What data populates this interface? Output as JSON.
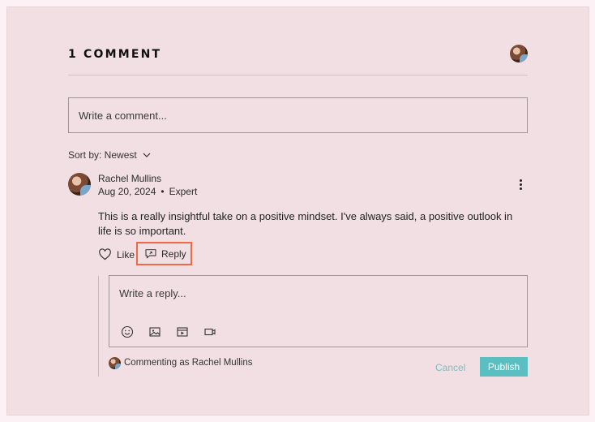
{
  "header": {
    "title": "1 COMMENT"
  },
  "composer": {
    "placeholder": "Write a comment..."
  },
  "sort": {
    "label": "Sort by: Newest"
  },
  "comment": {
    "author": "Rachel Mullins",
    "date": "Aug 20, 2024",
    "separator": "•",
    "role": "Expert",
    "text": "This is a really insightful take on a positive mindset. I've always said, a positive outlook in life is so important.",
    "like_label": "Like",
    "reply_label": "Reply"
  },
  "reply": {
    "placeholder": "Write a reply...",
    "tools": [
      "emoji-icon",
      "image-icon",
      "gif-icon",
      "video-icon"
    ],
    "commenting_as": "Commenting as Rachel Mullins",
    "cancel_label": "Cancel",
    "publish_label": "Publish"
  },
  "colors": {
    "background": "#f1dfe4",
    "accent": "#5bbfc2",
    "highlight": "#ee6a47"
  }
}
